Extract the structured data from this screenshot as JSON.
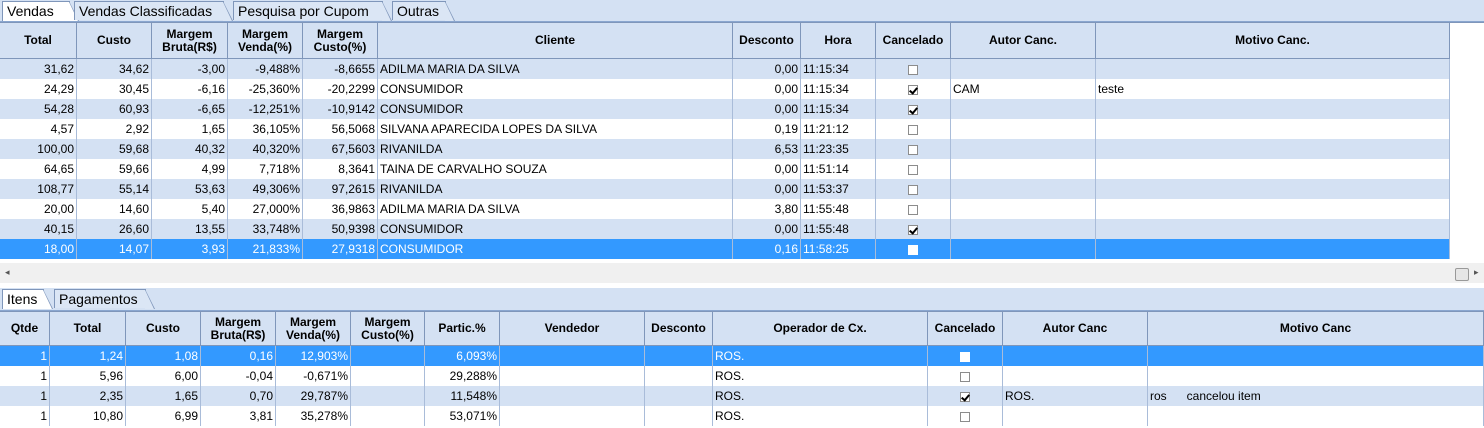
{
  "top_tabs": [
    "Vendas",
    "Vendas Classificadas",
    "Pesquisa por Cupom",
    "Outras"
  ],
  "top_grid": {
    "columns": [
      "Total",
      "Custo",
      "Margem Bruta(R$)",
      "Margem Venda(%)",
      "Margem Custo(%)",
      "Cliente",
      "Desconto",
      "Hora",
      "Cancelado",
      "Autor Canc.",
      "Motivo Canc."
    ],
    "rows": [
      {
        "total": "31,62",
        "custo": "34,62",
        "mbruta": "-3,00",
        "mvenda": "-9,488%",
        "mcusto": "-8,6655",
        "cliente": "ADILMA MARIA DA SILVA",
        "desconto": "0,00",
        "hora": "11:15:34",
        "cancelado": false,
        "autor": "",
        "motivo": ""
      },
      {
        "total": "24,29",
        "custo": "30,45",
        "mbruta": "-6,16",
        "mvenda": "-25,360%",
        "mcusto": "-20,2299",
        "cliente": "CONSUMIDOR",
        "desconto": "0,00",
        "hora": "11:15:34",
        "cancelado": true,
        "autor": "CAM",
        "motivo": "teste"
      },
      {
        "total": "54,28",
        "custo": "60,93",
        "mbruta": "-6,65",
        "mvenda": "-12,251%",
        "mcusto": "-10,9142",
        "cliente": "CONSUMIDOR",
        "desconto": "0,00",
        "hora": "11:15:34",
        "cancelado": true,
        "autor": "",
        "motivo": ""
      },
      {
        "total": "4,57",
        "custo": "2,92",
        "mbruta": "1,65",
        "mvenda": "36,105%",
        "mcusto": "56,5068",
        "cliente": "SILVANA APARECIDA LOPES DA SILVA",
        "desconto": "0,19",
        "hora": "11:21:12",
        "cancelado": false,
        "autor": "",
        "motivo": ""
      },
      {
        "total": "100,00",
        "custo": "59,68",
        "mbruta": "40,32",
        "mvenda": "40,320%",
        "mcusto": "67,5603",
        "cliente": "RIVANILDA",
        "desconto": "6,53",
        "hora": "11:23:35",
        "cancelado": false,
        "autor": "",
        "motivo": ""
      },
      {
        "total": "64,65",
        "custo": "59,66",
        "mbruta": "4,99",
        "mvenda": "7,718%",
        "mcusto": "8,3641",
        "cliente": "TAINA DE CARVALHO SOUZA",
        "desconto": "0,00",
        "hora": "11:51:14",
        "cancelado": false,
        "autor": "",
        "motivo": ""
      },
      {
        "total": "108,77",
        "custo": "55,14",
        "mbruta": "53,63",
        "mvenda": "49,306%",
        "mcusto": "97,2615",
        "cliente": "RIVANILDA",
        "desconto": "0,00",
        "hora": "11:53:37",
        "cancelado": false,
        "autor": "",
        "motivo": ""
      },
      {
        "total": "20,00",
        "custo": "14,60",
        "mbruta": "5,40",
        "mvenda": "27,000%",
        "mcusto": "36,9863",
        "cliente": "ADILMA MARIA DA SILVA",
        "desconto": "3,80",
        "hora": "11:55:48",
        "cancelado": false,
        "autor": "",
        "motivo": ""
      },
      {
        "total": "40,15",
        "custo": "26,60",
        "mbruta": "13,55",
        "mvenda": "33,748%",
        "mcusto": "50,9398",
        "cliente": "CONSUMIDOR",
        "desconto": "0,00",
        "hora": "11:55:48",
        "cancelado": true,
        "autor": "",
        "motivo": ""
      },
      {
        "total": "18,00",
        "custo": "14,07",
        "mbruta": "3,93",
        "mvenda": "21,833%",
        "mcusto": "27,9318",
        "cliente": "CONSUMIDOR",
        "desconto": "0,16",
        "hora": "11:58:25",
        "cancelado": false,
        "autor": "",
        "motivo": "",
        "selected": true
      }
    ]
  },
  "bottom_tabs": [
    "Itens",
    "Pagamentos"
  ],
  "bottom_grid": {
    "columns": [
      "Qtde",
      "Total",
      "Custo",
      "Margem Bruta(R$)",
      "Margem Venda(%)",
      "Margem Custo(%)",
      "Partic.%",
      "Vendedor",
      "Desconto",
      "Operador de Cx.",
      "Cancelado",
      "Autor Canc",
      "Motivo Canc"
    ],
    "rows": [
      {
        "qtde": "1",
        "total": "1,24",
        "custo": "1,08",
        "mbruta": "0,16",
        "mvenda": "12,903%",
        "mcusto": "",
        "partic": "6,093%",
        "vendedor": "",
        "desconto": "",
        "operador": "ROS.",
        "cancelado": false,
        "autor": "",
        "motivo": "",
        "selected": true
      },
      {
        "qtde": "1",
        "total": "5,96",
        "custo": "6,00",
        "mbruta": "-0,04",
        "mvenda": "-0,671%",
        "mcusto": "",
        "partic": "29,288%",
        "vendedor": "",
        "desconto": "",
        "operador": "ROS.",
        "cancelado": false,
        "autor": "",
        "motivo": ""
      },
      {
        "qtde": "1",
        "total": "2,35",
        "custo": "1,65",
        "mbruta": "0,70",
        "mvenda": "29,787%",
        "mcusto": "",
        "partic": "11,548%",
        "vendedor": "",
        "desconto": "",
        "operador": "ROS.",
        "cancelado": true,
        "autor": "ROS.",
        "motivo": "ros      cancelou item"
      },
      {
        "qtde": "1",
        "total": "10,80",
        "custo": "6,99",
        "mbruta": "3,81",
        "mvenda": "35,278%",
        "mcusto": "",
        "partic": "53,071%",
        "vendedor": "",
        "desconto": "",
        "operador": "ROS.",
        "cancelado": false,
        "autor": "",
        "motivo": ""
      }
    ]
  },
  "icons": {
    "scroll_left": "arrow-left-icon",
    "scroll_right": "arrow-right-icon"
  }
}
